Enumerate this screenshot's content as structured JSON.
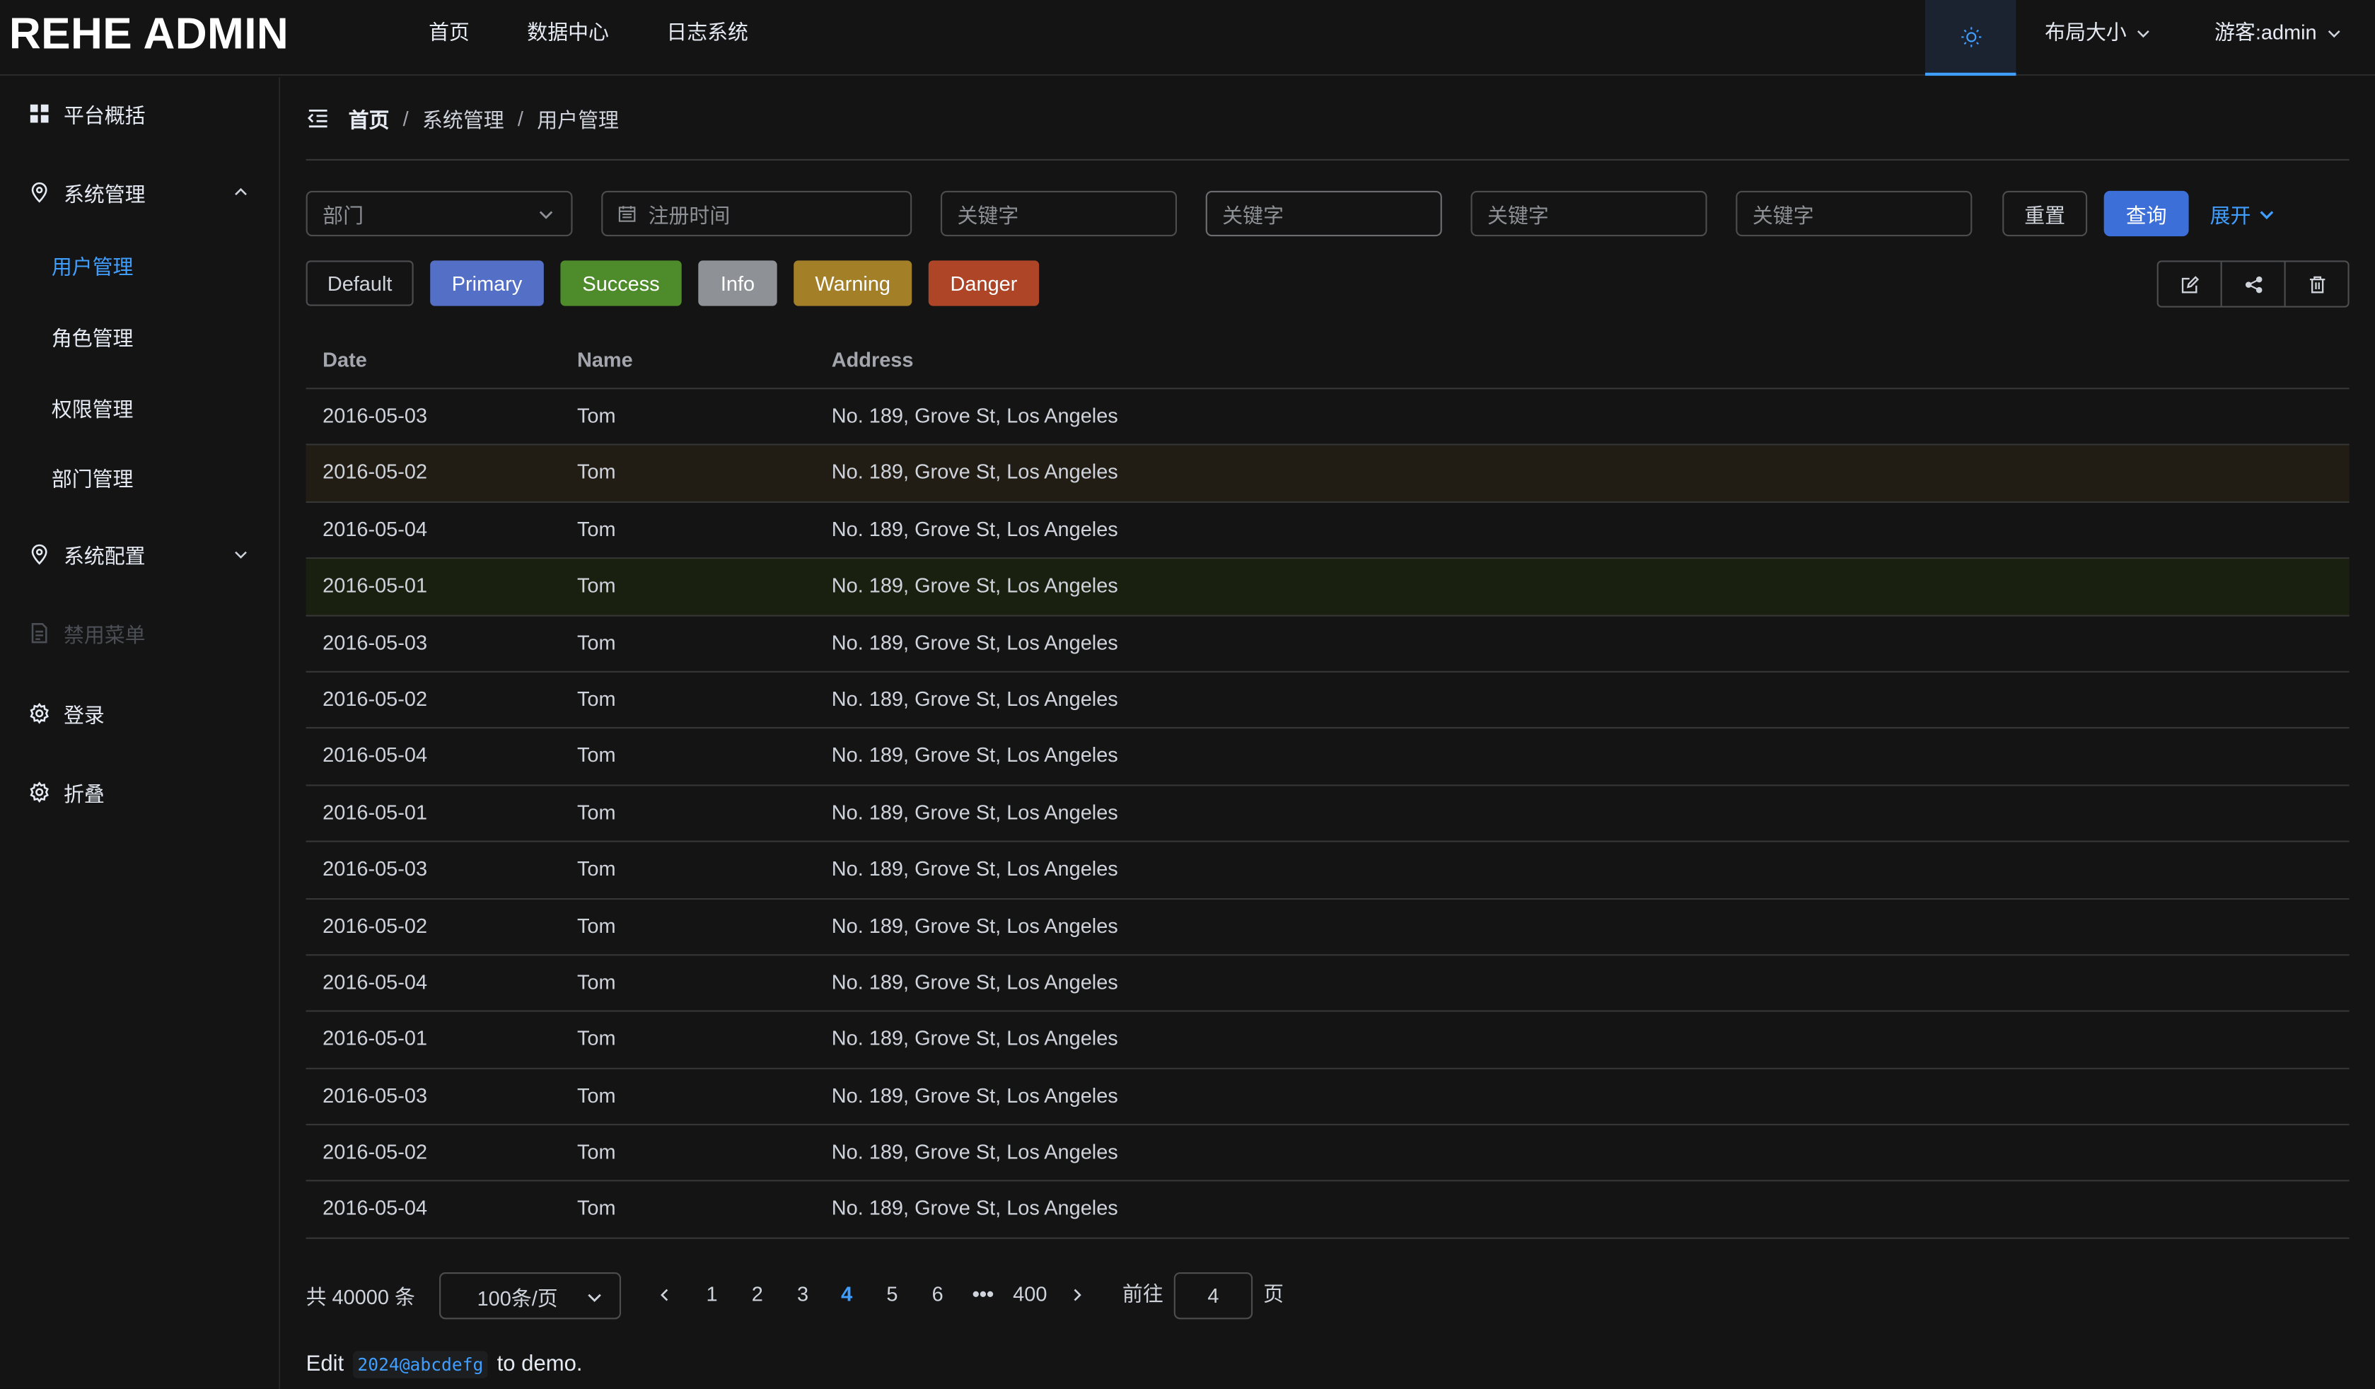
{
  "app": {
    "logo": "REHE ADMIN"
  },
  "topnav": [
    "首页",
    "数据中心",
    "日志系统"
  ],
  "header": {
    "layout_size": "布局大小",
    "user": "游客:admin"
  },
  "sidebar": {
    "items": [
      {
        "label": "平台概括",
        "icon": "grid-icon"
      },
      {
        "label": "系统管理",
        "icon": "location-icon"
      },
      {
        "label": "系统配置",
        "icon": "location-icon"
      },
      {
        "label": "禁用菜单",
        "icon": "document-icon"
      },
      {
        "label": "登录",
        "icon": "gear-icon"
      },
      {
        "label": "折叠",
        "icon": "gear-icon"
      }
    ],
    "sub_items": [
      "用户管理",
      "角色管理",
      "权限管理",
      "部门管理"
    ]
  },
  "breadcrumb": [
    "首页",
    "系统管理",
    "用户管理"
  ],
  "filters": {
    "department_placeholder": "部门",
    "register_time_placeholder": "注册时间",
    "keyword_placeholder": "关键字",
    "reset_label": "重置",
    "query_label": "查询",
    "expand_label": "展开"
  },
  "type_buttons": [
    "Default",
    "Primary",
    "Success",
    "Info",
    "Warning",
    "Danger"
  ],
  "colors": {
    "primary": "#5470c6",
    "success": "#4e8b2b",
    "info": "#8e9196",
    "warning": "#a37f28",
    "danger": "#ae4527",
    "accent": "#409eff"
  },
  "table": {
    "headers": [
      "Date",
      "Name",
      "Address"
    ],
    "rows": [
      [
        "2016-05-03",
        "Tom",
        "No. 189, Grove St, Los Angeles"
      ],
      [
        "2016-05-02",
        "Tom",
        "No. 189, Grove St, Los Angeles"
      ],
      [
        "2016-05-04",
        "Tom",
        "No. 189, Grove St, Los Angeles"
      ],
      [
        "2016-05-01",
        "Tom",
        "No. 189, Grove St, Los Angeles"
      ],
      [
        "2016-05-03",
        "Tom",
        "No. 189, Grove St, Los Angeles"
      ],
      [
        "2016-05-02",
        "Tom",
        "No. 189, Grove St, Los Angeles"
      ],
      [
        "2016-05-04",
        "Tom",
        "No. 189, Grove St, Los Angeles"
      ],
      [
        "2016-05-01",
        "Tom",
        "No. 189, Grove St, Los Angeles"
      ],
      [
        "2016-05-03",
        "Tom",
        "No. 189, Grove St, Los Angeles"
      ],
      [
        "2016-05-02",
        "Tom",
        "No. 189, Grove St, Los Angeles"
      ],
      [
        "2016-05-04",
        "Tom",
        "No. 189, Grove St, Los Angeles"
      ],
      [
        "2016-05-01",
        "Tom",
        "No. 189, Grove St, Los Angeles"
      ],
      [
        "2016-05-03",
        "Tom",
        "No. 189, Grove St, Los Angeles"
      ],
      [
        "2016-05-02",
        "Tom",
        "No. 189, Grove St, Los Angeles"
      ],
      [
        "2016-05-04",
        "Tom",
        "No. 189, Grove St, Los Angeles"
      ]
    ]
  },
  "pagination": {
    "total_text": "共 40000 条",
    "page_size": "100条/页",
    "pages": [
      "1",
      "2",
      "3",
      "4",
      "5",
      "6",
      "•••",
      "400"
    ],
    "current": "4",
    "goto_label": "前往",
    "goto_value": "4",
    "goto_unit": "页"
  },
  "footer": {
    "prefix": "Edit",
    "code": "2024@abcdefg",
    "suffix": "to demo."
  }
}
